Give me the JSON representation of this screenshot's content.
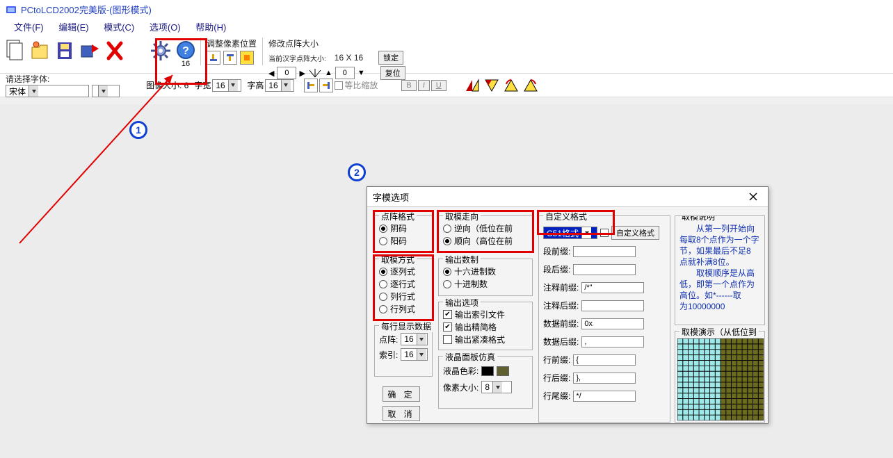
{
  "window": {
    "title": "PCtoLCD2002完美版-(图形模式)"
  },
  "menu": {
    "file": "文件(F)",
    "edit": "编辑(E)",
    "mode": "模式(C)",
    "options": "选项(O)",
    "help": "帮助(H)"
  },
  "toolbar": {
    "font_prompt": "请选择字体:",
    "font_value": "宋体",
    "font_size_value": "",
    "image_size_label": "图像大小: 6",
    "char_width_label": "字宽",
    "char_width_value": "16",
    "char_height_label": "字高",
    "char_height_value": "16",
    "adjust_pixels_label": "调整像素位置",
    "scale_label_chk": "等比缩放",
    "modify_matrix_label": "修改点阵大小",
    "current_matrix_label": "当前汉字点阵大小:",
    "matrix_size": "16 X 16",
    "spin1": "0",
    "spin2": "0",
    "lock_btn": "锁定",
    "reset_btn": "复位",
    "b": "B",
    "i": "I",
    "u": "U",
    "help_icon_num": "16"
  },
  "annotations": {
    "badge1": "1",
    "badge2": "2"
  },
  "dialog": {
    "title": "字模选项",
    "groups": {
      "matrix_format": {
        "title": "点阵格式",
        "opt_neg": "阴码",
        "opt_pos": "阳码"
      },
      "scan_method": {
        "title": "取模方式",
        "opt1": "逐列式",
        "opt2": "逐行式",
        "opt3": "列行式",
        "opt4": "行列式"
      },
      "scan_dir": {
        "title": "取模走向",
        "opt_rev": "逆向（低位在前",
        "opt_fwd": "顺向（高位在前"
      },
      "out_radix": {
        "title": "输出数制",
        "opt_hex": "十六进制数",
        "opt_dec": "十进制数"
      },
      "out_opts": {
        "title": "输出选项",
        "chk_index": "输出索引文件",
        "chk_compact": "输出精简格",
        "chk_tight": "输出紧凑格式"
      },
      "lcd_sim": {
        "title": "液晶面板仿真",
        "color_label": "液晶色彩:",
        "pixel_label": "像素大小:",
        "pixel_value": "8"
      },
      "custom_fmt": {
        "title": "自定义格式",
        "combo_value": "C51格式",
        "btn": "自定义格式"
      },
      "help": {
        "title": "取模说明",
        "text1": "从第一列开始向",
        "text2": "每取8个点作为一个字",
        "text3": "节，如果最后不足8",
        "text4": "点就补满8位。",
        "text5": "取模顺序是从高",
        "text6": "低，即第一个点作为",
        "text7": "高位。如*------取",
        "text8": "为10000000"
      },
      "demo_title": "取模演示（从低位到"
    },
    "row_label": "每行显示数据",
    "row_matrix_label": "点阵:",
    "row_matrix_value": "16",
    "row_index_label": "索引:",
    "row_index_value": "16",
    "fields": {
      "seg_pre": {
        "label": "段前缀:",
        "value": ""
      },
      "seg_suf": {
        "label": "段后缀:",
        "value": ""
      },
      "cmt_pre": {
        "label": "注释前缀:",
        "value": "/*\""
      },
      "cmt_suf": {
        "label": "注释后缀:",
        "value": ""
      },
      "data_pre": {
        "label": "数据前缀:",
        "value": "0x"
      },
      "data_suf": {
        "label": "数据后缀:",
        "value": ","
      },
      "line_pre": {
        "label": "行前缀:",
        "value": "{"
      },
      "line_suf": {
        "label": "行后缀:",
        "value": "},"
      },
      "line_end": {
        "label": "行尾缀:",
        "value": "*/"
      }
    },
    "ok_btn": "确 定",
    "cancel_btn": "取 消"
  }
}
